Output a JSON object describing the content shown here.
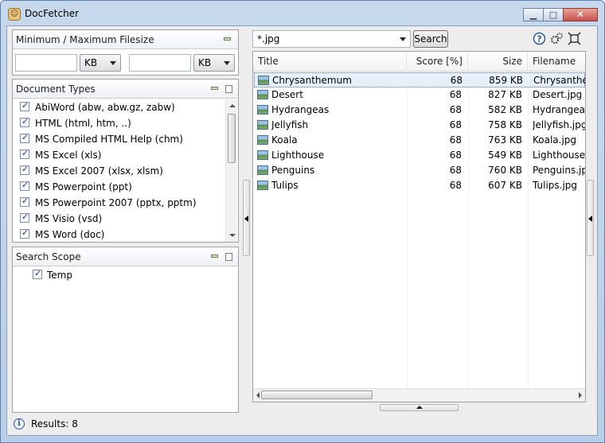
{
  "window": {
    "title": "DocFetcher",
    "caption_buttons": {
      "minimize": "▁",
      "maximize": "□",
      "close": "✕"
    }
  },
  "filesize_panel": {
    "title": "Minimum / Maximum Filesize",
    "min_value": "",
    "min_unit": "KB",
    "max_value": "",
    "max_unit": "KB"
  },
  "doctypes_panel": {
    "title": "Document Types",
    "items": [
      {
        "label": "AbiWord (abw, abw.gz, zabw)",
        "checked": true
      },
      {
        "label": "HTML (html, htm, ..)",
        "checked": true
      },
      {
        "label": "MS Compiled HTML Help (chm)",
        "checked": true
      },
      {
        "label": "MS Excel (xls)",
        "checked": true
      },
      {
        "label": "MS Excel 2007 (xlsx, xlsm)",
        "checked": true
      },
      {
        "label": "MS Powerpoint (ppt)",
        "checked": true
      },
      {
        "label": "MS Powerpoint 2007 (pptx, pptm)",
        "checked": true
      },
      {
        "label": "MS Visio (vsd)",
        "checked": true
      },
      {
        "label": "MS Word (doc)",
        "checked": true
      }
    ]
  },
  "scope_panel": {
    "title": "Search Scope",
    "items": [
      {
        "label": "Temp",
        "checked": true
      }
    ]
  },
  "search": {
    "query": "*.jpg",
    "button_label": "Search",
    "icons": [
      "help-icon",
      "preferences-icon",
      "toggle-layout-icon"
    ]
  },
  "results": {
    "columns": [
      "Title",
      "Score [%]",
      "Size",
      "Filename"
    ],
    "rows": [
      {
        "title": "Chrysanthemum",
        "score": "68",
        "size": "859 KB",
        "filename": "Chrysanthemum.jpg"
      },
      {
        "title": "Desert",
        "score": "68",
        "size": "827 KB",
        "filename": "Desert.jpg"
      },
      {
        "title": "Hydrangeas",
        "score": "68",
        "size": "582 KB",
        "filename": "Hydrangeas.jpg"
      },
      {
        "title": "Jellyfish",
        "score": "68",
        "size": "758 KB",
        "filename": "Jellyfish.jpg"
      },
      {
        "title": "Koala",
        "score": "68",
        "size": "763 KB",
        "filename": "Koala.jpg"
      },
      {
        "title": "Lighthouse",
        "score": "68",
        "size": "549 KB",
        "filename": "Lighthouse.jpg"
      },
      {
        "title": "Penguins",
        "score": "68",
        "size": "760 KB",
        "filename": "Penguins.jpg"
      },
      {
        "title": "Tulips",
        "score": "68",
        "size": "607 KB",
        "filename": "Tulips.jpg"
      }
    ],
    "selected_index": 0
  },
  "status": {
    "text": "Results: 8"
  },
  "colors": {
    "selection": "#e5f0fb",
    "title_bar": "#c6d8ec",
    "check": "#1c3c8a"
  }
}
